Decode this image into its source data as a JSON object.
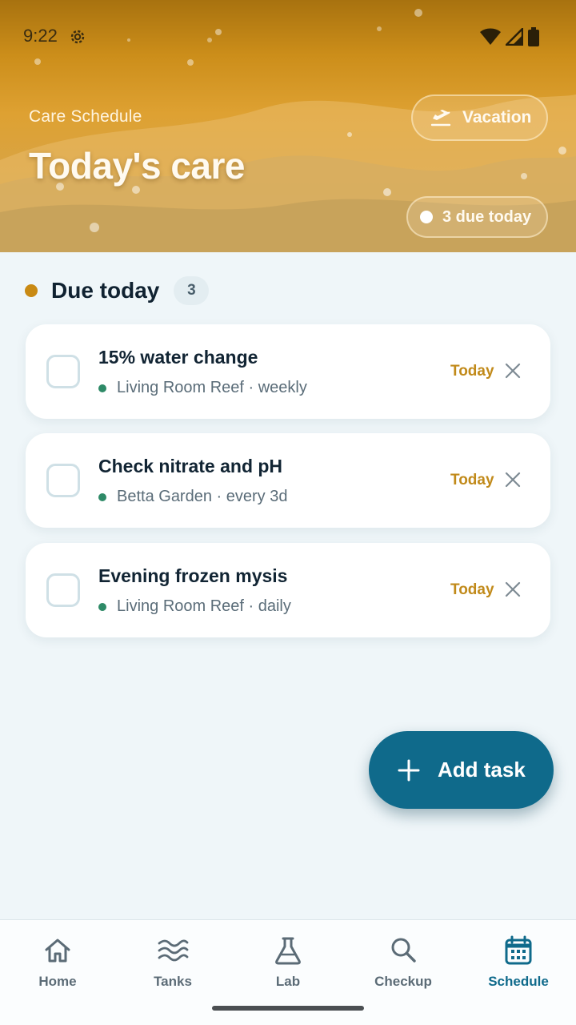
{
  "status_bar": {
    "time": "9:22",
    "icons": [
      "gear-icon",
      "wifi-icon",
      "signal-icon",
      "battery-icon"
    ]
  },
  "header": {
    "eyebrow": "Care Schedule",
    "title": "Today's care",
    "vacation_label": "Vacation",
    "due_today_label": "3 due today"
  },
  "section": {
    "title": "Due today",
    "count": "3"
  },
  "tasks": [
    {
      "title": "15% water change",
      "tank": "Living Room Reef",
      "frequency": "weekly",
      "meta": "Living Room Reef · weekly",
      "due": "Today"
    },
    {
      "title": "Check nitrate and pH",
      "tank": "Betta Garden",
      "frequency": "every 3d",
      "meta": "Betta Garden · every 3d",
      "due": "Today"
    },
    {
      "title": "Evening frozen mysis",
      "tank": "Living Room Reef",
      "frequency": "daily",
      "meta": "Living Room Reef · daily",
      "due": "Today"
    }
  ],
  "fab": {
    "label": "Add task",
    "icon": "plus-icon"
  },
  "bottom_nav": {
    "items": [
      {
        "label": "Home",
        "icon": "home-icon",
        "active": false
      },
      {
        "label": "Tanks",
        "icon": "waves-icon",
        "active": false
      },
      {
        "label": "Lab",
        "icon": "flask-icon",
        "active": false
      },
      {
        "label": "Checkup",
        "icon": "search-icon",
        "active": false
      },
      {
        "label": "Schedule",
        "icon": "calendar-icon",
        "active": true
      }
    ]
  },
  "colors": {
    "accent": "#0f6a8b",
    "header_gold": "#dea132",
    "due_text": "#c18a1a",
    "tank_dot": "#2e8a67"
  }
}
